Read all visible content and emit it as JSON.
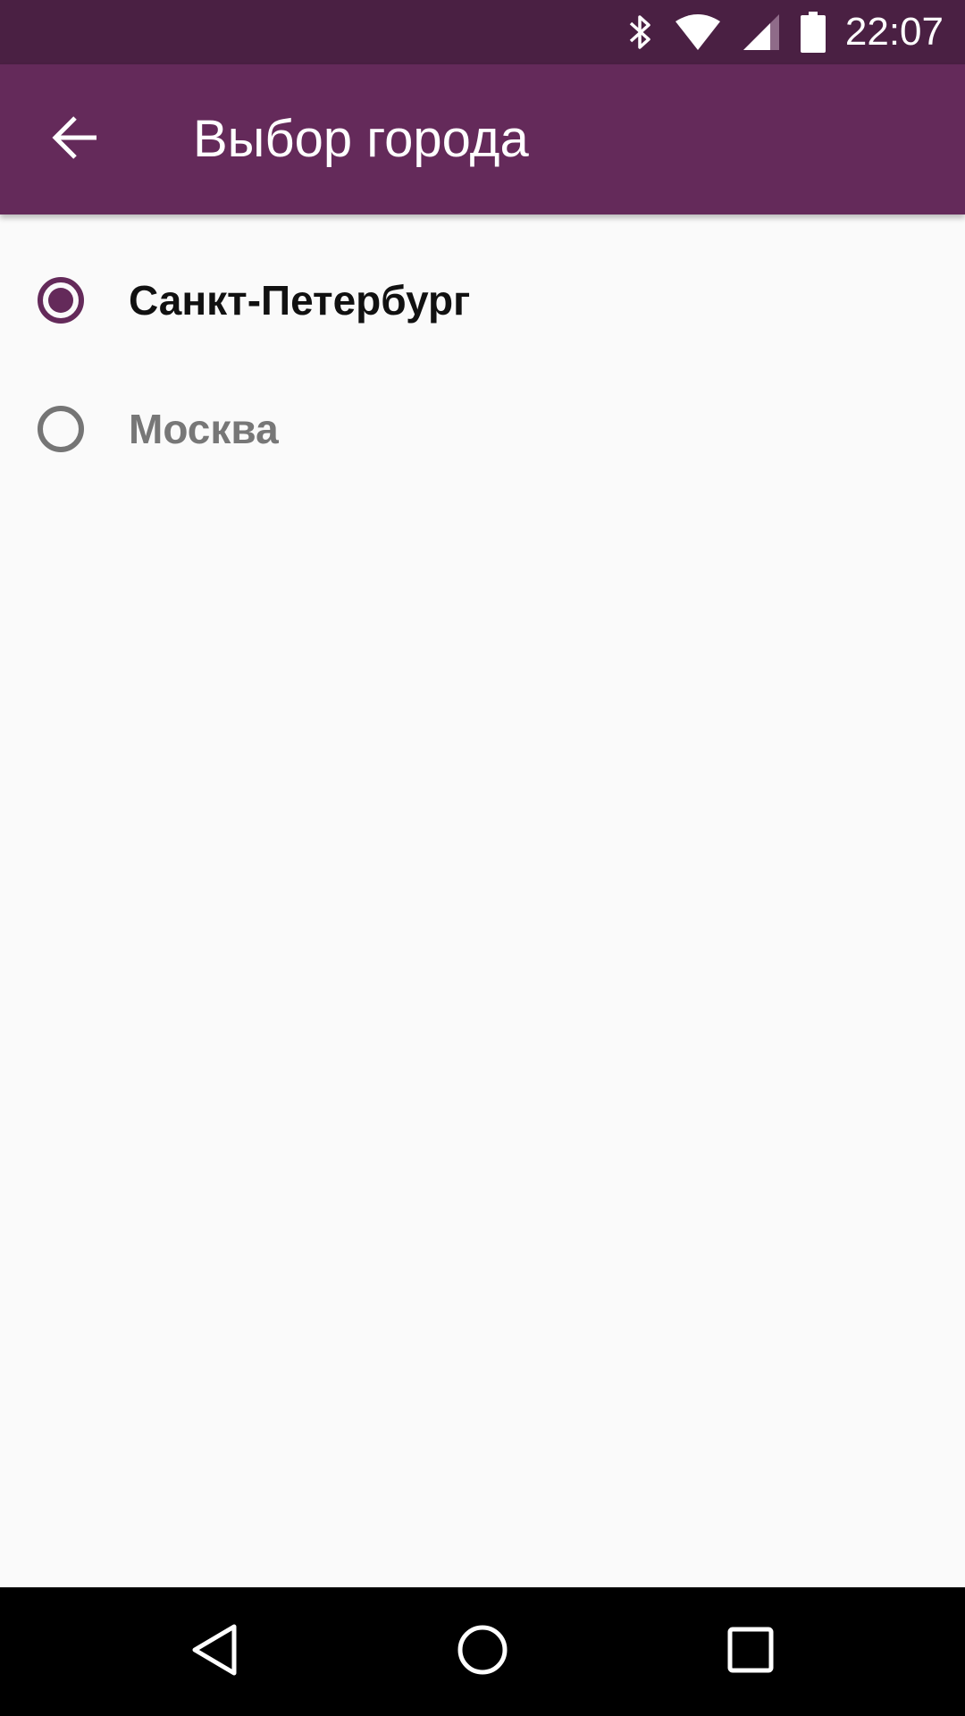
{
  "status_bar": {
    "time": "22:07",
    "icons": [
      "bluetooth-icon",
      "wifi-icon",
      "cell-signal-icon",
      "battery-icon"
    ]
  },
  "app_bar": {
    "title": "Выбор города",
    "back_icon": "arrow-back-icon",
    "background_color": "#642a5a"
  },
  "cities": [
    {
      "label": "Санкт-Петербург",
      "selected": true
    },
    {
      "label": "Москва",
      "selected": false
    }
  ],
  "nav_bar": {
    "buttons": [
      "back-triangle-icon",
      "home-circle-icon",
      "recents-square-icon"
    ]
  },
  "colors": {
    "status_bar": "#4a2043",
    "accent": "#642a5a",
    "unchecked": "#757575",
    "background": "#fafafa"
  }
}
